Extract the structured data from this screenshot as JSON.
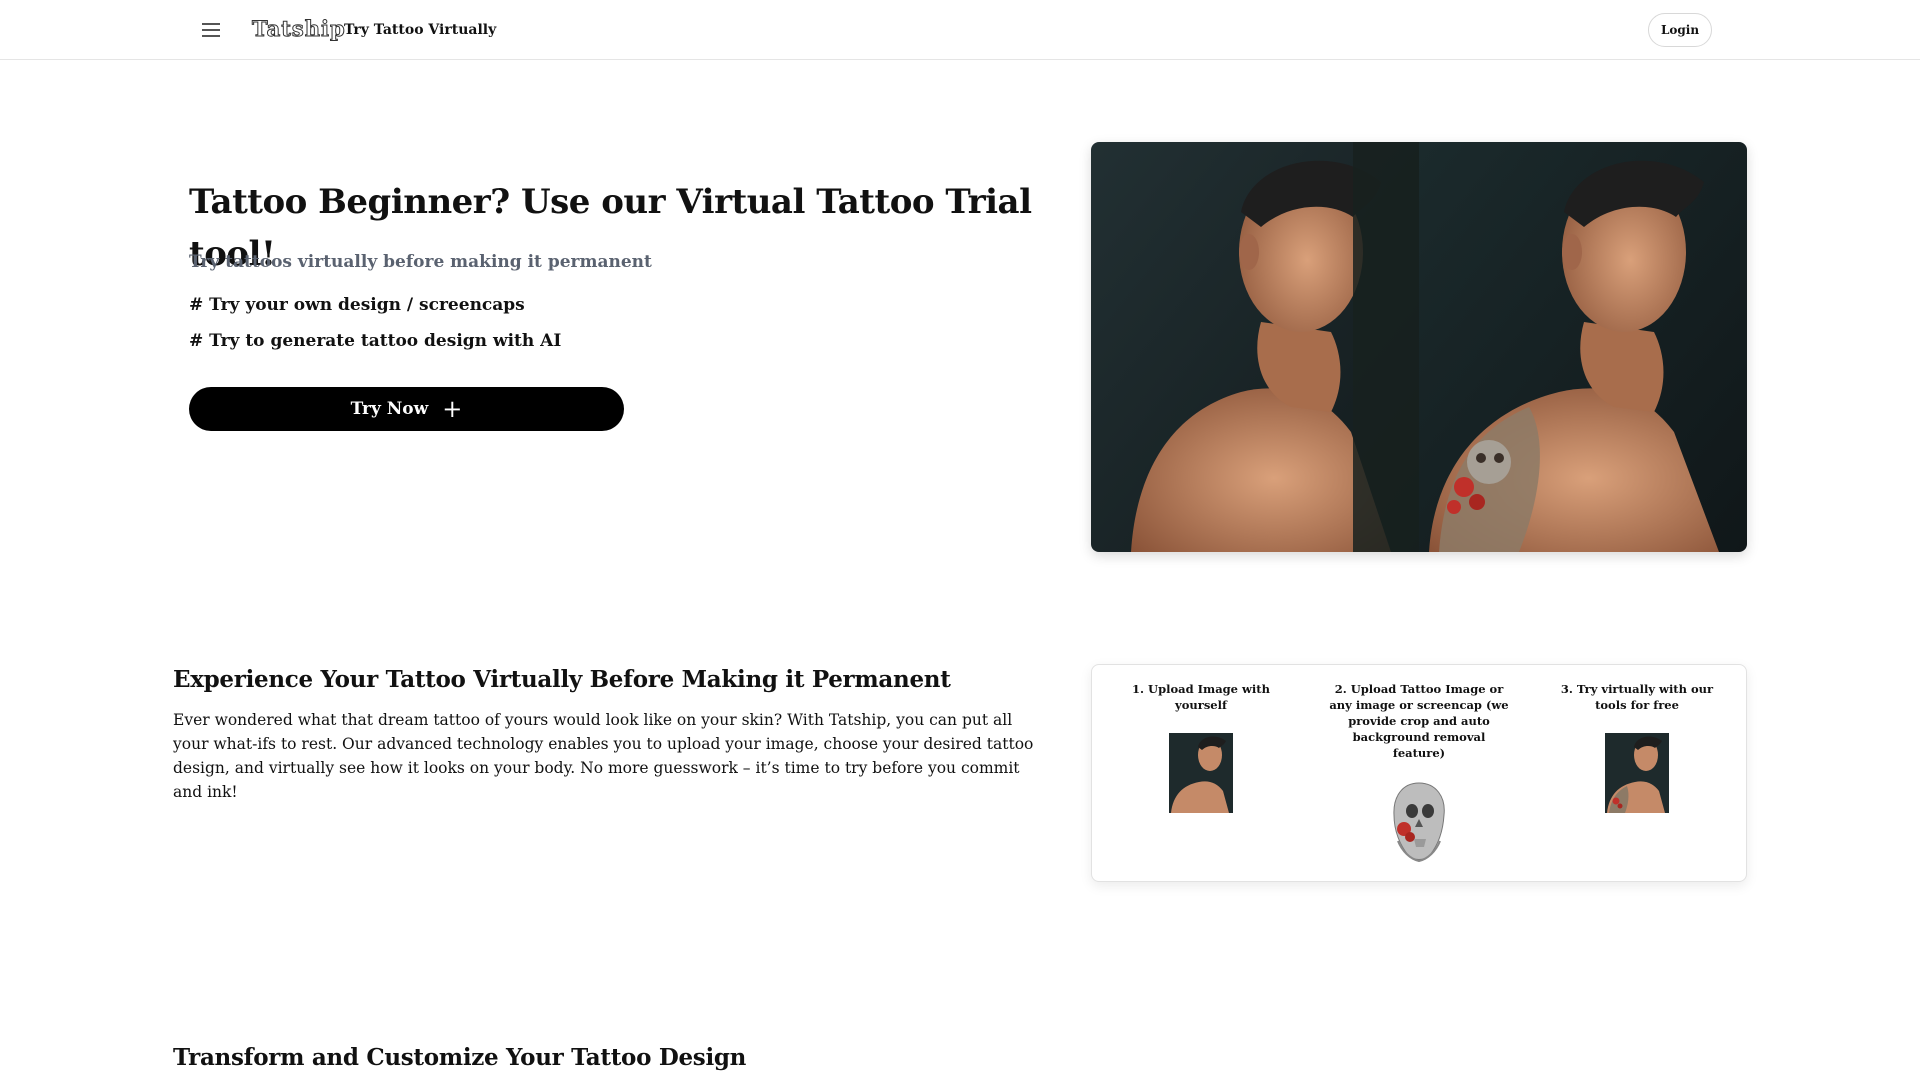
{
  "nav": {
    "logo": "Tatship",
    "title": "Try Tattoo Virtually",
    "login_label": "Login",
    "menu_icon": "hamburger-icon"
  },
  "hero": {
    "title": "Tattoo Beginner? Use our Virtual Tattoo Trial tool!",
    "subtitle": "Try tattoos virtually before making it permanent",
    "bullet1": "# Try your own design / screencaps",
    "bullet2": "# Try to generate tattoo design with AI",
    "cta_label": "Try Now",
    "cta_icon": "plus-icon"
  },
  "experience": {
    "title": "Experience Your Tattoo Virtually Before Making it Permanent",
    "body": "Ever wondered what that dream tattoo of yours would look like on your skin? With Tatship, you can put all your what-ifs to rest. Our advanced technology enables you to upload your image, choose your desired tattoo design, and virtually see how it looks on your body. No more guesswork – it’s time to try before you commit and ink!",
    "steps": [
      {
        "label": "1. Upload Image with yourself"
      },
      {
        "label": "2. Upload Tattoo Image or any image or screencap (we provide crop and auto background removal feature)"
      },
      {
        "label": "3. Try virtually with our tools for free"
      }
    ]
  },
  "transform": {
    "title": "Transform and Customize Your Tattoo Design"
  },
  "colors": {
    "cta_bg": "#000000",
    "subtitle": "#5a6270",
    "photo_bg": "#1b2427",
    "skin": "#c58a68",
    "tattoo_red": "#c0302a"
  }
}
